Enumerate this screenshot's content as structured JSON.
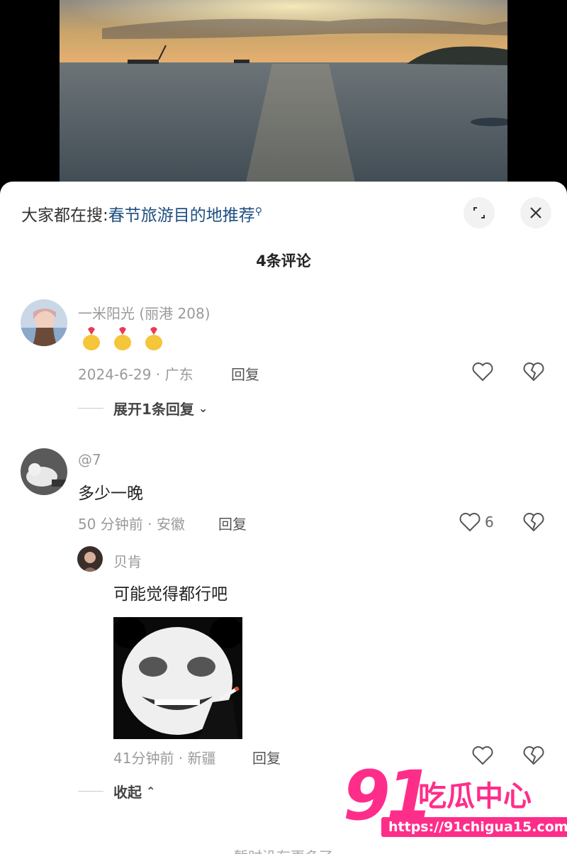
{
  "search": {
    "prefix": "大家都在搜:",
    "term": "春节旅游目的地推荐"
  },
  "comments_count": "4条评论",
  "comments": [
    {
      "username": "一米阳光 (丽港 208)",
      "text": "",
      "emoji_count": 3,
      "meta": "2024-6-29 · 广东",
      "reply_label": "回复",
      "like_count": "",
      "expand_label": "展开1条回复"
    },
    {
      "username": "@7",
      "text": "多少一晚",
      "meta": "50 分钟前 · 安徽",
      "reply_label": "回复",
      "like_count": "6",
      "replies": [
        {
          "username": "贝肯",
          "text": "可能觉得都行吧",
          "meta": "41分钟前 · 新疆",
          "reply_label": "回复",
          "collapse_label": "收起"
        }
      ]
    }
  ],
  "bottom_text": "暂时没有更多了",
  "watermark": {
    "number": "91",
    "brand": "吃瓜中心",
    "url": "https://91chigua15.com"
  },
  "colors": {
    "search_term": "#1f4f80",
    "watermark": "#ff2d8a",
    "meta_gray": "#9a9a9a"
  }
}
